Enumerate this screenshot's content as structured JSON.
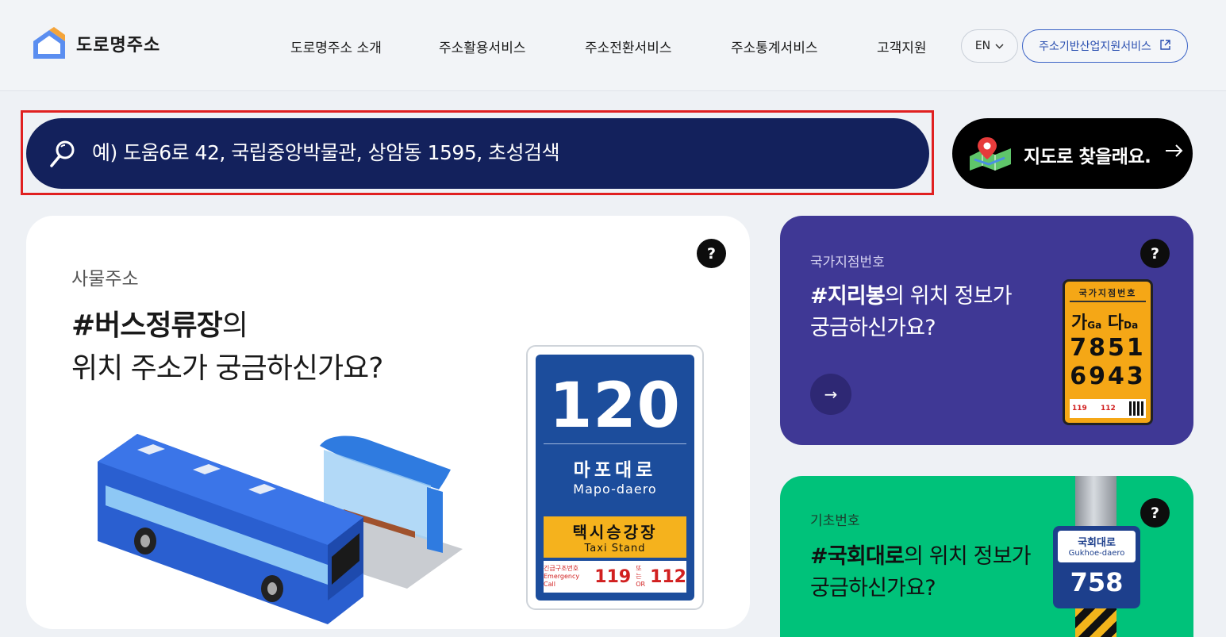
{
  "header": {
    "logo_text": "도로명주소",
    "nav": [
      {
        "label": "도로명주소 소개"
      },
      {
        "label": "주소활용서비스"
      },
      {
        "label": "주소전환서비스"
      },
      {
        "label": "주소통계서비스"
      },
      {
        "label": "고객지원"
      }
    ],
    "lang_label": "EN",
    "industry_label": "주소기반산업지원서비스"
  },
  "search": {
    "placeholder": "예) 도움6로 42, 국립중앙박물관, 상암동 1595, 초성검색",
    "map_button_label": "지도로 찾을래요."
  },
  "main_card": {
    "eyebrow": "사물주소",
    "headline_bold": "#버스정류장",
    "headline_rest1": "의",
    "headline_line2": "위치 주소가 궁금하신가요?",
    "help": "?",
    "sign": {
      "number": "120",
      "name_ko": "마포대로",
      "name_en": "Mapo-daero",
      "taxi_ko": "택시승강장",
      "taxi_en": "Taxi Stand",
      "emergency_ko": "긴급구조번호",
      "emergency_en": "Emergency Call",
      "emergency_119": "119",
      "emergency_or": "또는 OR",
      "emergency_112": "112"
    }
  },
  "purple_card": {
    "eyebrow": "국가지점번호",
    "headline_bold": "#지리봉",
    "headline_rest1": "의 위치 정보가",
    "headline_line2": "궁금하신가요?",
    "help": "?",
    "arrow": "→",
    "plate": {
      "title": "국가지점번호",
      "ga": "가",
      "ga_en": "Ga",
      "da": "다",
      "da_en": "Da",
      "num1": "7851",
      "num2": "6943",
      "foot_119": "119",
      "foot_112": "112"
    }
  },
  "green_card": {
    "eyebrow": "기초번호",
    "headline_bold": "#국회대로",
    "headline_rest1": "의 위치 정보가",
    "headline_line2": "궁금하신가요?",
    "help": "?",
    "plate": {
      "name_ko": "국회대로",
      "name_en": "Gukhoe-daero",
      "number": "758"
    }
  },
  "colors": {
    "search_bg": "#13215c",
    "highlight": "#e02020",
    "purple": "#3f3895",
    "green": "#00c27a",
    "link_blue": "#2a4fb0"
  }
}
